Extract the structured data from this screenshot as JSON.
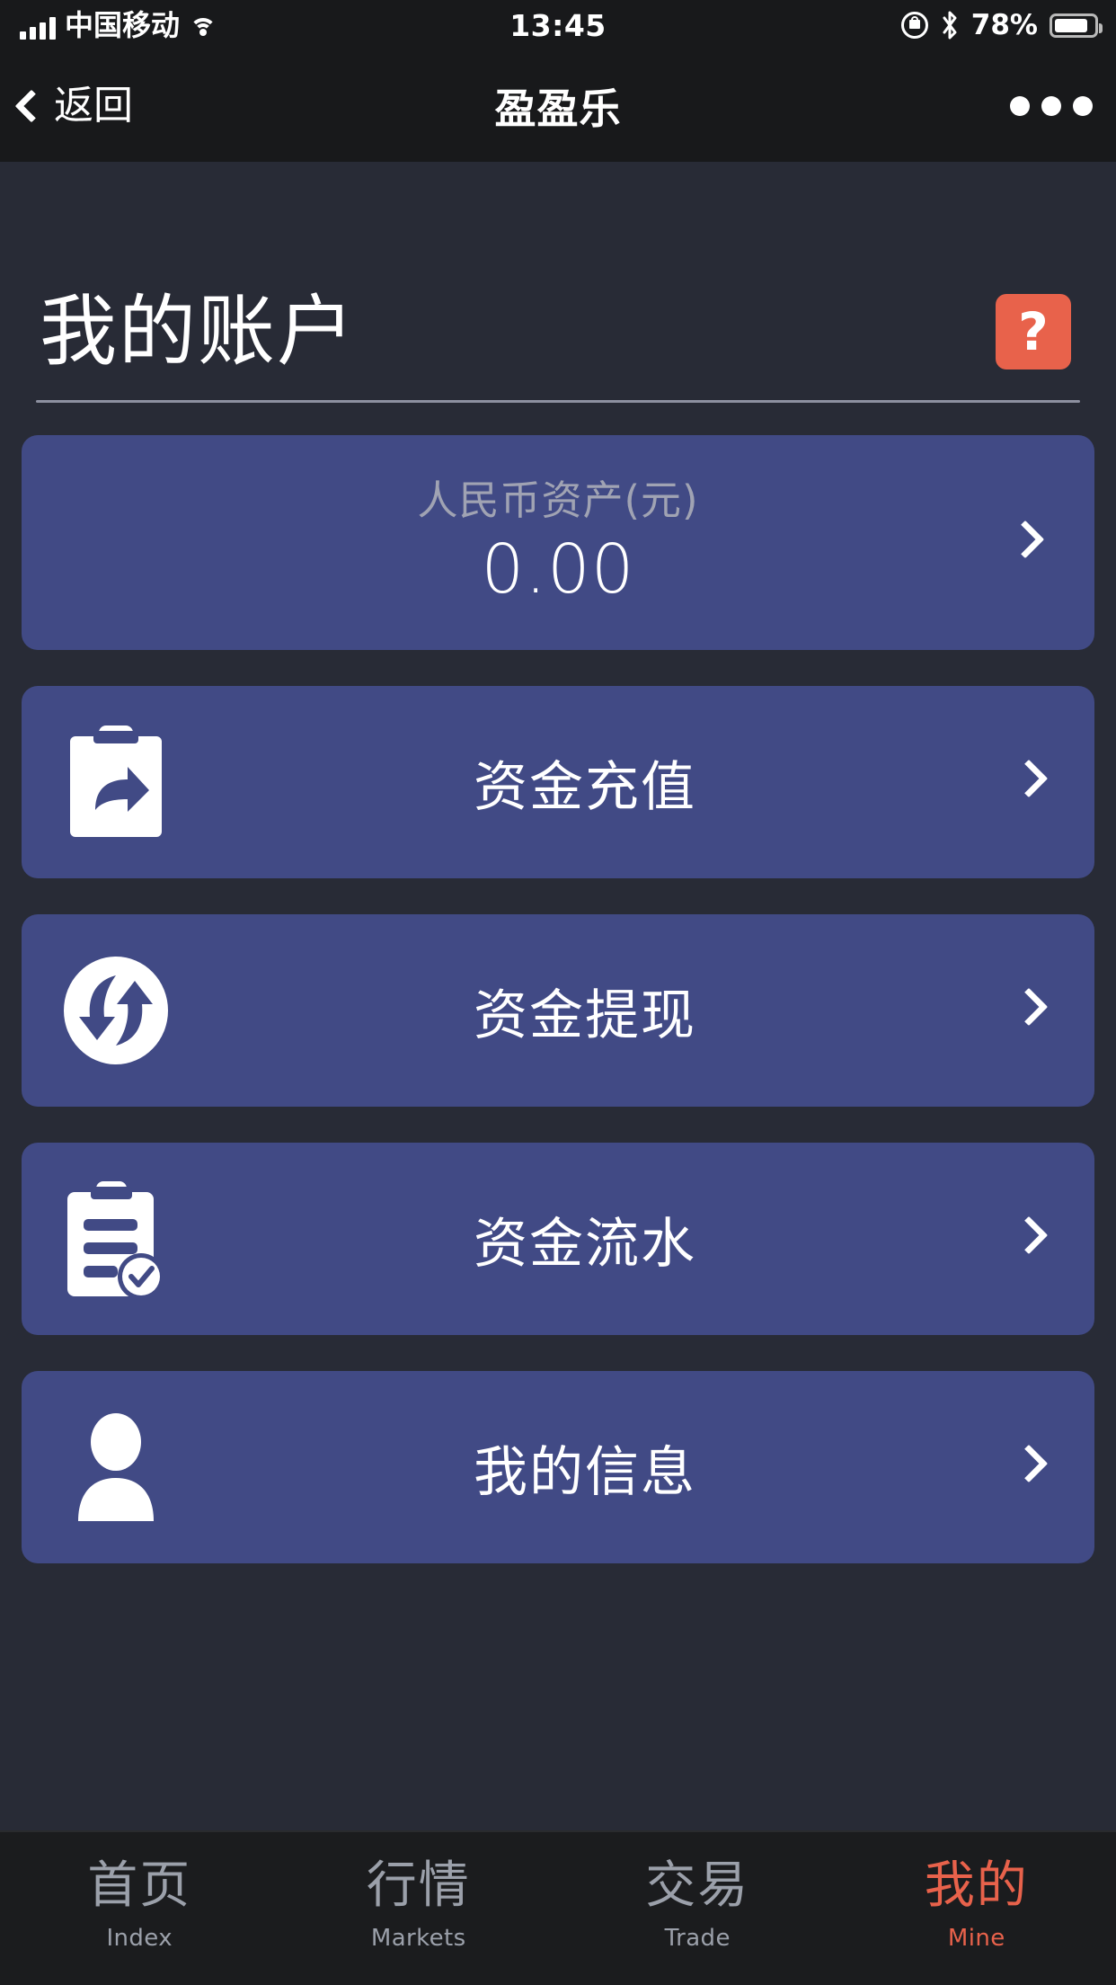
{
  "status_bar": {
    "carrier": "中国移动",
    "time": "13:45",
    "battery_percent": "78%",
    "signal_icon": "signal-bars-icon",
    "wifi_icon": "wifi-icon",
    "rotation_lock_icon": "rotation-lock-icon",
    "bluetooth_icon": "bluetooth-icon",
    "battery_icon": "battery-icon"
  },
  "nav_bar": {
    "back_label": "返回",
    "title": "盈盈乐",
    "more_icon": "more-dots-icon",
    "back_icon": "chevron-left-icon"
  },
  "page": {
    "title": "我的账户",
    "help_label": "?"
  },
  "balance_card": {
    "label": "人民币资产(元)",
    "value": "0.00",
    "chevron_icon": "chevron-right-icon"
  },
  "menu_items": [
    {
      "label": "资金充值",
      "icon": "clipboard-share-icon"
    },
    {
      "label": "资金提现",
      "icon": "circular-exchange-icon"
    },
    {
      "label": "资金流水",
      "icon": "checklist-icon"
    },
    {
      "label": "我的信息",
      "icon": "person-icon"
    }
  ],
  "tab_bar": [
    {
      "cn": "首页",
      "en": "Index",
      "active": false
    },
    {
      "cn": "行情",
      "en": "Markets",
      "active": false
    },
    {
      "cn": "交易",
      "en": "Trade",
      "active": false
    },
    {
      "cn": "我的",
      "en": "Mine",
      "active": true
    }
  ],
  "colors": {
    "page_background": "#282b36",
    "bar_background": "#18191b",
    "card_purple": "#414a85",
    "accent_orange": "#e8624b",
    "muted_text": "#9ba0aa",
    "divider": "#8d90a0"
  }
}
